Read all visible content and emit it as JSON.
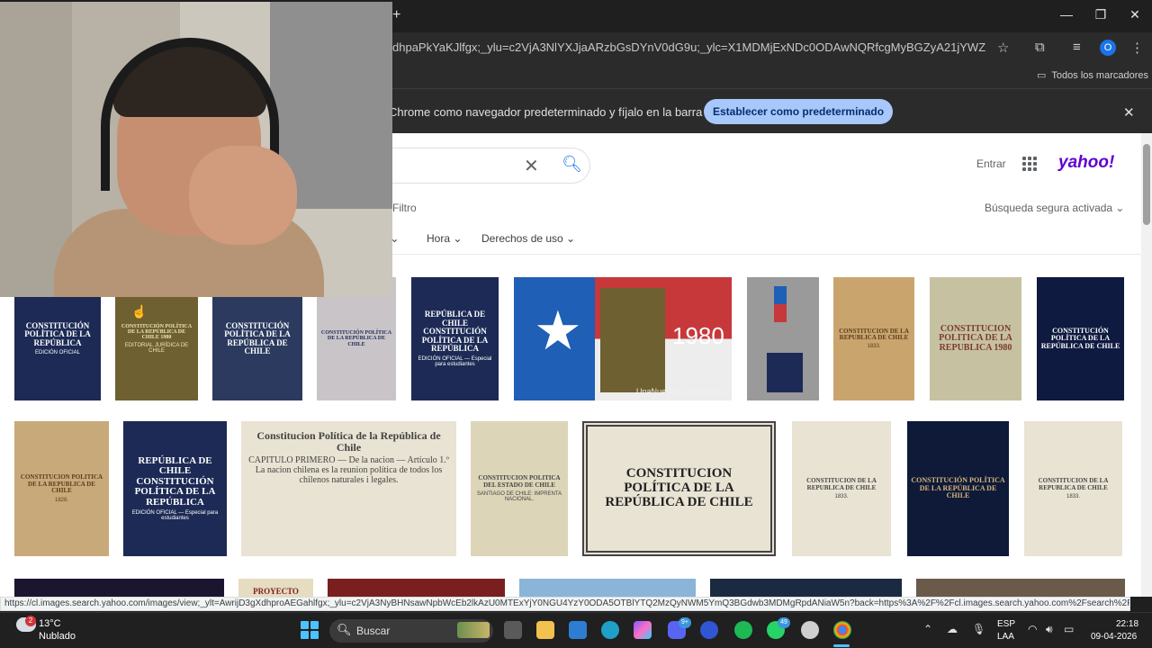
{
  "browser": {
    "new_tab": "+",
    "url": "dhpaPkYaKJlfgx;_ylu=c2VjA3NlYXJjaARzbGsDYnV0dG9u;_ylc=X1MDMjExNDc0ODAwNQRfcgMyBGZyA21jYWZlZQRmcjIDcDpzL...",
    "profile_initial": "O",
    "bookmarks_all": "Todos los marcadores",
    "infobar_text": "Chrome como navegador predeterminado y fíjalo en la barra de tareas",
    "set_default_label": "Establecer como predeterminado",
    "win": {
      "minimize": "—",
      "maximize": "❐",
      "close": "✕"
    }
  },
  "page": {
    "sign_in": "Entrar",
    "logo": "yahoo!",
    "filter_label": "Filtro",
    "safesearch": "Búsqueda segura activada ⌄",
    "filters": [
      {
        "label": "s ⌄"
      },
      {
        "label": "Hora ⌄"
      },
      {
        "label": "Derechos de uso ⌄"
      }
    ],
    "thumbs": [
      {
        "title": "CONSTITUCIÓN POLÍTICA DE LA REPÚBLICA",
        "sub": "EDICIÓN OFICIAL"
      },
      {
        "title": "CONSTITUCIÓN POLÍTICA DE LA REPÚBLICA DE CHILE 1980",
        "sub": "EDITORIAL JURÍDICA DE CHILE"
      },
      {
        "title": "CONSTITUCIÓN POLÍTICA DE LA REPÚBLICA DE CHILE",
        "sub": ""
      },
      {
        "title": "CONSTITUCIÓN POLÍTICA DE LA REPÚBLICA DE CHILE",
        "sub": ""
      },
      {
        "title": "REPÚBLICA DE CHILE CONSTITUCIÓN POLÍTICA DE LA REPÚBLICA",
        "sub": "EDICIÓN OFICIAL — Especial para estudiantes"
      },
      {
        "title": "1980",
        "sub": "UnaNuevaConstitución.cl"
      },
      {
        "title": "",
        "sub": ""
      },
      {
        "title": "CONSTITUCION DE LA REPUBLICA DE CHILE",
        "sub": "1833."
      },
      {
        "title": "CONSTITUCION POLITICA DE LA REPUBLICA 1980",
        "sub": ""
      },
      {
        "title": "CONSTITUCIÓN POLÍTICA DE LA REPÚBLICA DE CHILE",
        "sub": ""
      },
      {
        "title": "CONSTITUCION POLITICA DE LA REPUBLICA DE CHILE",
        "sub": "1828."
      },
      {
        "title": "REPÚBLICA DE CHILE CONSTITUCIÓN POLÍTICA DE LA REPÚBLICA",
        "sub": "EDICIÓN OFICIAL — Especial para estudiantes"
      },
      {
        "title": "Constitucion Política de la República de Chile",
        "sub": "CAPITULO PRIMERO — De la nacion — Artículo 1.º La nacion chilena es la reunion política de todos los chilenos naturales i legales."
      },
      {
        "title": "CONSTITUCION POLITICA DEL ESTADO DE CHILE",
        "sub": "SANTIAGO DE CHILE: IMPRENTA NACIONAL."
      },
      {
        "title": "CONSTITUCION POLÍTICA DE LA REPÚBLICA DE CHILE",
        "sub": ""
      },
      {
        "title": "CONSTITUCION DE LA REPUBLICA DE CHILE",
        "sub": "1833."
      },
      {
        "title": "CONSTITUCIÓN POLÍTICA DE LA REPÚBLICA DE CHILE",
        "sub": ""
      },
      {
        "title": "CONSTITUCION DE LA REPUBLICA DE CHILE",
        "sub": "1833."
      },
      {
        "title": "",
        "sub": ""
      },
      {
        "title": "PROYECTO",
        "sub": ""
      },
      {
        "title": "",
        "sub": ""
      },
      {
        "title": "",
        "sub": ""
      },
      {
        "title": "",
        "sub": ""
      },
      {
        "title": "",
        "sub": ""
      }
    ],
    "status_url": "https://cl.images.search.yahoo.com/images/view;_ylt=AwrijD3gXdhproAEGahlfgx;_ylu=c2VjA3NyBHNsawNpbWcEb2lkAzU0MTExYjY0NGU4YzY0ODA5OTBlYTQ2MzQyNWM5YmQ3BGdwb3MDMgRpdANiaW5n?back=https%3A%2F%2Fcl.images.search.yahoo.com%2Fsearch%2Fimag..."
  },
  "taskbar": {
    "weather_badge": "2",
    "weather_temp": "13°C",
    "weather_desc": "Nublado",
    "search_label": "Buscar",
    "discord_badge": "9+",
    "whatsapp_badge": "49",
    "lang1": "ESP",
    "lang2": "LAA",
    "time": "22:18",
    "date": "09-04-2026"
  }
}
